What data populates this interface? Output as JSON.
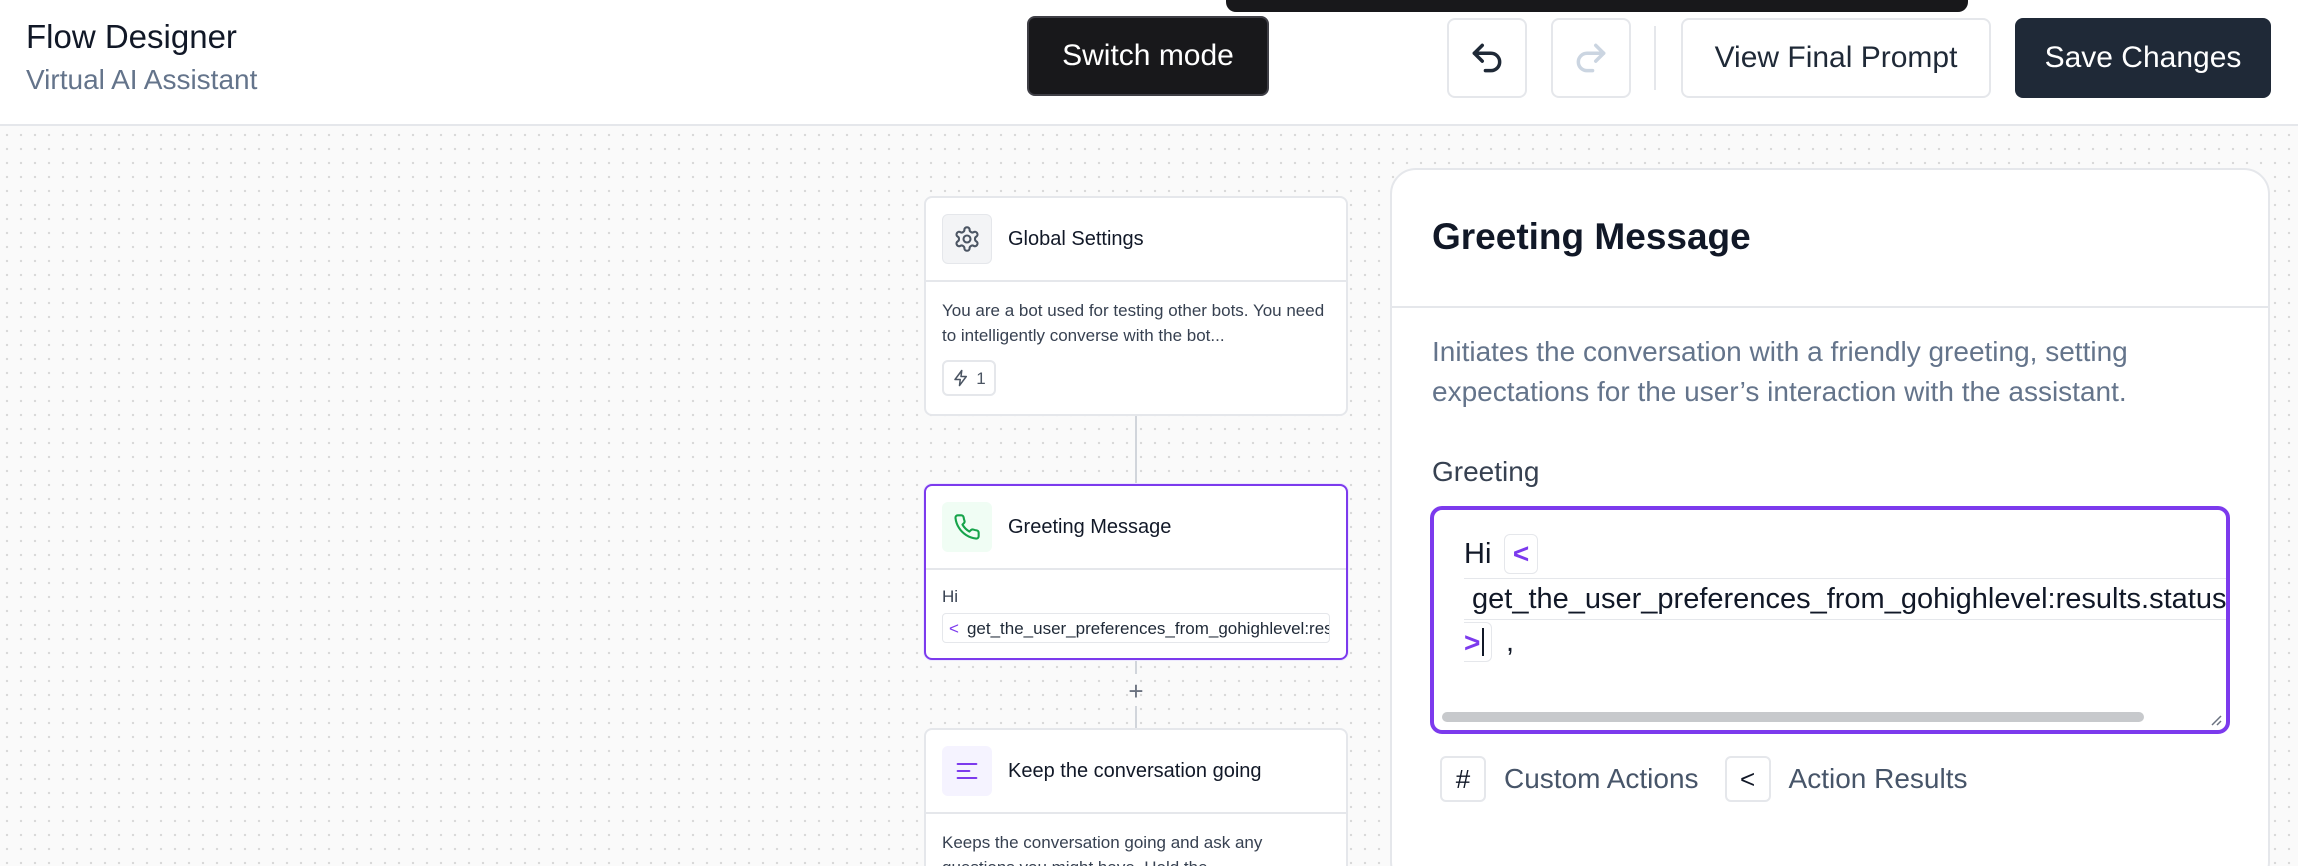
{
  "header": {
    "title": "Flow Designer",
    "subtitle": "Virtual AI Assistant",
    "switch_mode_label": "Switch mode",
    "undo_icon": "undo-icon",
    "redo_icon": "redo-icon",
    "view_prompt_label": "View Final Prompt",
    "save_label": "Save Changes"
  },
  "nodes": [
    {
      "title": "Global Settings",
      "icon": "gear-icon",
      "body": "You are a bot used for testing other bots. You need to intelligently converse with the bot...",
      "badge_count": "1"
    },
    {
      "title": "Greeting Message",
      "icon": "phone-icon",
      "body_line": "Hi",
      "chip_prefix": "<",
      "chip_text": "get_the_user_preferences_from_gohighlevel:results.status"
    },
    {
      "title": "Keep the conversation going",
      "icon": "lines-icon",
      "body": "Keeps the conversation going and ask any questions you might have. Hold the"
    }
  ],
  "add_step_label": "+",
  "panel": {
    "title": "Greeting Message",
    "description": "Initiates the conversation with a friendly greeting, setting expectations for the user’s interaction with the assistant.",
    "field_label": "Greeting",
    "editor": {
      "greeting": "Hi",
      "chip_open": "<",
      "chip_text": "get_the_user_preferences_from_gohighlevel:results.status",
      "chip_close": ">",
      "trailing": ","
    },
    "tools": [
      {
        "key": "#",
        "label": "Custom Actions"
      },
      {
        "key": "<",
        "label": "Action Results"
      }
    ]
  },
  "colors": {
    "accent": "#7c3aed",
    "dark_button": "#1f2937",
    "muted_text": "#64748b"
  }
}
